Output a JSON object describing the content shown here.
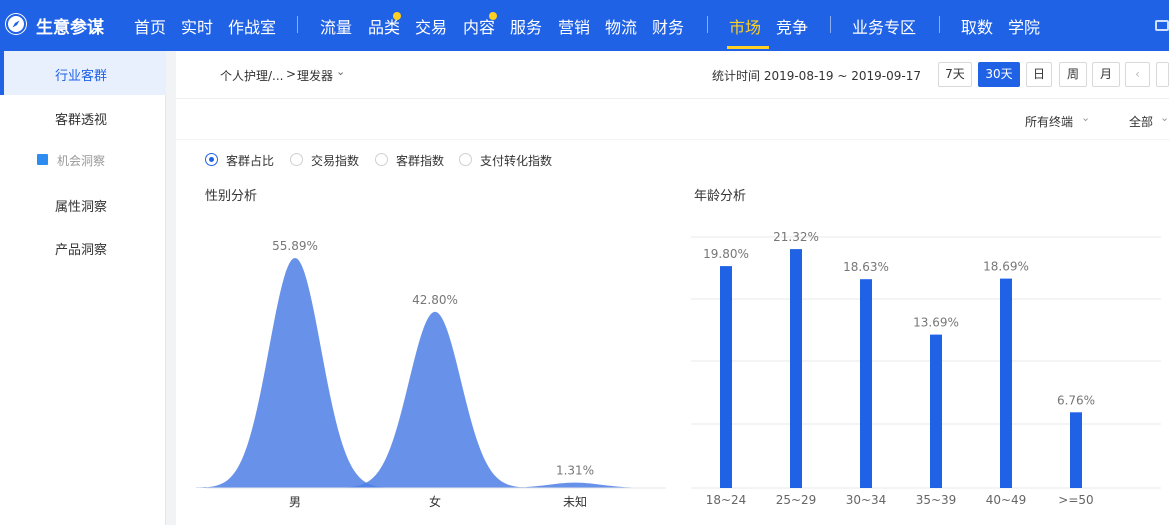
{
  "topnav": {
    "brand": "生意参谋",
    "items": [
      "首页",
      "实时",
      "作战室",
      "流量",
      "品类",
      "交易",
      "内容",
      "服务",
      "营销",
      "物流",
      "财务",
      "市场",
      "竞争",
      "业务专区",
      "取数",
      "学院"
    ],
    "active": "市场"
  },
  "sidebar": {
    "items": [
      "行业客群",
      "客群透视",
      "机会洞察",
      "属性洞察",
      "产品洞察"
    ]
  },
  "header": {
    "breadcrumb_parent": "个人护理/...",
    "breadcrumb_sep": ">",
    "breadcrumb_current": "理发器",
    "stat_time": "统计时间 2019-08-19 ~ 2019-09-17",
    "period_buttons": [
      "7天",
      "30天",
      "日",
      "周",
      "月"
    ],
    "active_period": "30天",
    "filter_terminal": "所有终端",
    "filter_all": "全部"
  },
  "metric_options": [
    "客群占比",
    "交易指数",
    "客群指数",
    "支付转化指数"
  ],
  "selected_metric": "客群占比",
  "colors": {
    "primary": "#2062e6",
    "accent": "#ffd021",
    "gender_area": "#4d7fe6"
  },
  "chart_data": [
    {
      "type": "area",
      "title": "性别分析",
      "categories": [
        "男",
        "女",
        "未知"
      ],
      "values": [
        55.89,
        42.8,
        1.31
      ],
      "value_labels": [
        "55.89%",
        "42.80%",
        "1.31%"
      ]
    },
    {
      "type": "bar",
      "title": "年龄分析",
      "categories": [
        "18~24",
        "25~29",
        "30~34",
        "35~39",
        "40~49",
        ">=50"
      ],
      "values": [
        19.8,
        21.32,
        18.63,
        13.69,
        18.69,
        6.76
      ],
      "value_labels": [
        "19.80%",
        "21.32%",
        "18.63%",
        "13.69%",
        "18.69%",
        "6.76%"
      ],
      "grid": true
    }
  ]
}
